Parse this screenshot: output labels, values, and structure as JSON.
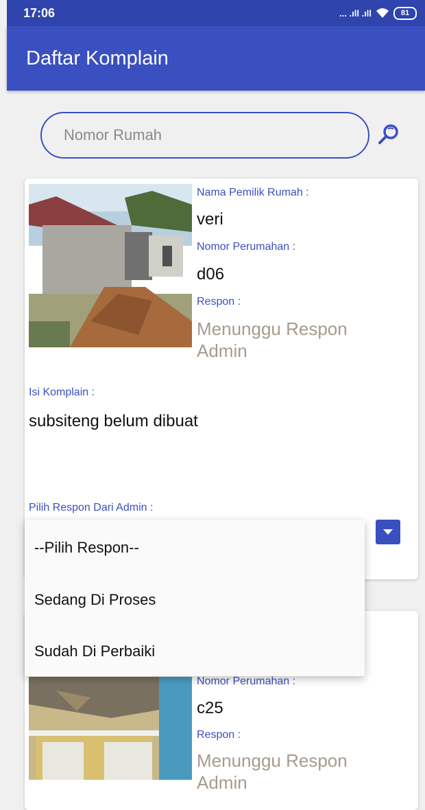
{
  "status_bar": {
    "time": "17:06",
    "signal": "... .ıll .ıll",
    "battery": "81"
  },
  "app_bar": {
    "title": "Daftar Komplain"
  },
  "search": {
    "placeholder": "Nomor Rumah"
  },
  "cards": [
    {
      "owner_label": "Nama Pemilik Rumah :",
      "owner": "veri",
      "house_label": "Nomor Perumahan :",
      "house": "d06",
      "response_label": "Respon :",
      "response": "Menunggu Respon Admin",
      "complaint_label": "Isi Komplain :",
      "complaint": "subsiteng belum dibuat",
      "select_label": "Pilih Respon Dari Admin :"
    },
    {
      "house_label": "Nomor Perumahan :",
      "house": "c25",
      "response_label": "Respon :",
      "response": "Menunggu Respon Admin"
    }
  ],
  "dropdown": {
    "options": [
      "--Pilih Respon--",
      "Sedang Di Proses",
      "Sudah Di Perbaiki"
    ]
  },
  "colors": {
    "primary": "#3a4fc0",
    "status_bar": "#2f44ad",
    "response_text": "#a89a8c"
  },
  "icons": {
    "search": "search-icon",
    "dropdown": "chevron-down-icon"
  }
}
